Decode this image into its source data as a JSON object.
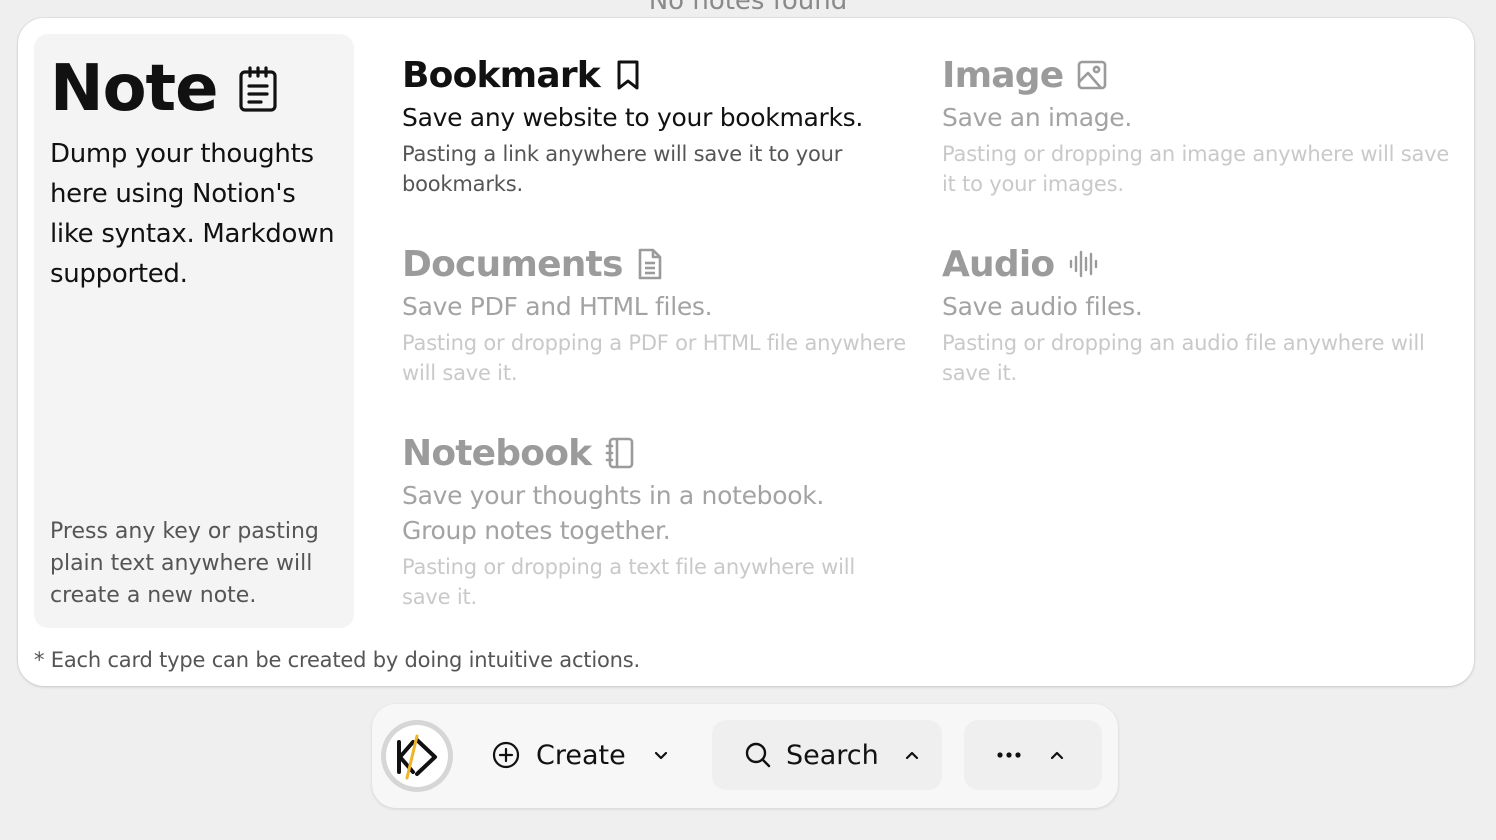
{
  "top_hint": "No notes found",
  "note_card": {
    "title": "Note",
    "description": "Dump your thoughts here using Notion's like syntax. Markdown supported.",
    "footer": "Press any key or pasting plain text anywhere will create a new note.",
    "icon": "notepad-icon"
  },
  "types": [
    {
      "name": "Bookmark",
      "icon": "bookmark-icon",
      "subtitle": "Save any website to your bookmarks.",
      "hint": "Pasting a link anywhere will save it to your bookmarks.",
      "state": "active"
    },
    {
      "name": "Image",
      "icon": "image-icon",
      "subtitle": "Save an image.",
      "hint": "Pasting or dropping an image anywhere will save it to your images.",
      "state": "muted"
    },
    {
      "name": "Documents",
      "icon": "document-icon",
      "subtitle": "Save PDF and HTML files.",
      "hint": "Pasting or dropping a PDF or HTML file anywhere will save it.",
      "state": "muted"
    },
    {
      "name": "Audio",
      "icon": "audio-waveform-icon",
      "subtitle": "Save audio files.",
      "hint": "Pasting or dropping an audio file anywhere will save it.",
      "state": "muted"
    },
    {
      "name": "Notebook",
      "icon": "notebook-icon",
      "subtitle": "Save your thoughts in a notebook. Group notes together.",
      "hint": "Pasting or dropping a text file anywhere will save it.",
      "state": "muted"
    }
  ],
  "footnote": "* Each card type can be created by doing intuitive actions.",
  "dock": {
    "avatar_icon": "kd-logo-icon",
    "create_label": "Create",
    "search_label": "Search",
    "more_icon": "ellipsis-icon"
  },
  "colors": {
    "background": "#efefef",
    "panel": "#ffffff",
    "note_card": "#f4f4f4",
    "accent_logo": "#f0b429"
  }
}
